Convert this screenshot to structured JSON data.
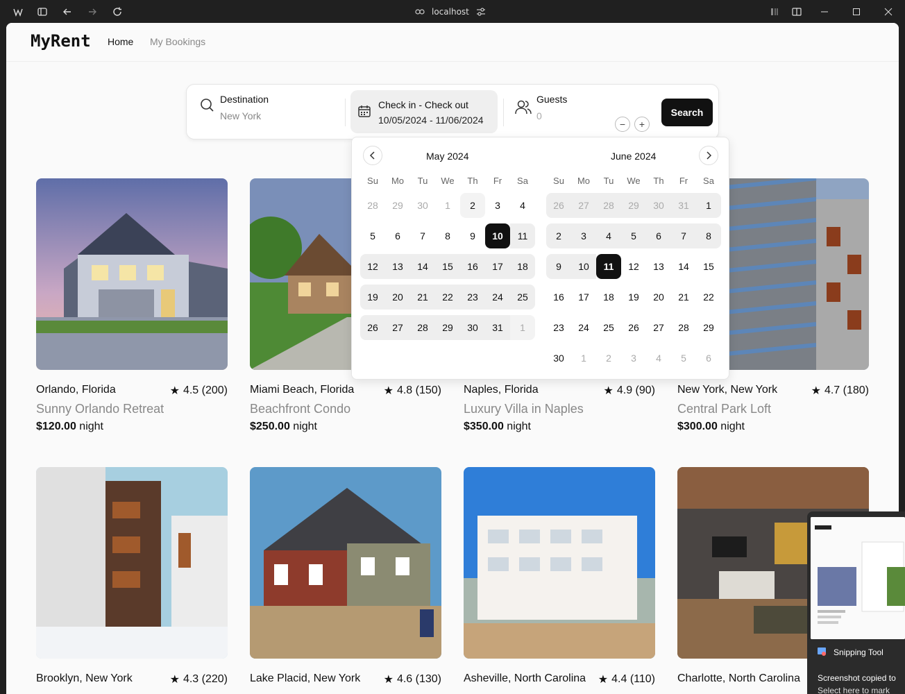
{
  "browser": {
    "url": "localhost"
  },
  "nav": {
    "logo": "MyRent",
    "links": [
      "Home",
      "My Bookings"
    ]
  },
  "search": {
    "destination_label": "Destination",
    "destination_value": "New York",
    "dates_label": "Check in - Check out",
    "dates_value": "10/05/2024 - 11/06/2024",
    "guests_label": "Guests",
    "guests_value": "0",
    "decrement": "−",
    "increment": "+",
    "button": "Search"
  },
  "calendar": {
    "weekdays": [
      "Su",
      "Mo",
      "Tu",
      "We",
      "Th",
      "Fr",
      "Sa"
    ],
    "left_title": "May 2024",
    "right_title": "June 2024",
    "left_weeks": [
      [
        "28",
        "29",
        "30",
        "1",
        "2",
        "3",
        "4"
      ],
      [
        "5",
        "6",
        "7",
        "8",
        "9",
        "10",
        "11"
      ],
      [
        "12",
        "13",
        "14",
        "15",
        "16",
        "17",
        "18"
      ],
      [
        "19",
        "20",
        "21",
        "22",
        "23",
        "24",
        "25"
      ],
      [
        "26",
        "27",
        "28",
        "29",
        "30",
        "31",
        "1"
      ]
    ],
    "right_weeks": [
      [
        "26",
        "27",
        "28",
        "29",
        "30",
        "31",
        "1"
      ],
      [
        "2",
        "3",
        "4",
        "5",
        "6",
        "7",
        "8"
      ],
      [
        "9",
        "10",
        "11",
        "12",
        "13",
        "14",
        "15"
      ],
      [
        "16",
        "17",
        "18",
        "19",
        "20",
        "21",
        "22"
      ],
      [
        "23",
        "24",
        "25",
        "26",
        "27",
        "28",
        "29"
      ],
      [
        "30",
        "1",
        "2",
        "3",
        "4",
        "5",
        "6"
      ]
    ]
  },
  "listings": [
    {
      "location": "Orlando, Florida",
      "rating": "4.5 (200)",
      "title": "Sunny Orlando Retreat",
      "price": "$120.00",
      "unit": "night"
    },
    {
      "location": "Miami Beach, Florida",
      "rating": "4.8 (150)",
      "title": "Beachfront Condo",
      "price": "$250.00",
      "unit": "night"
    },
    {
      "location": "Naples, Florida",
      "rating": "4.9 (90)",
      "title": "Luxury Villa in Naples",
      "price": "$350.00",
      "unit": "night"
    },
    {
      "location": "New York, New York",
      "rating": "4.7 (180)",
      "title": "Central Park Loft",
      "price": "$300.00",
      "unit": "night"
    },
    {
      "location": "Brooklyn, New York",
      "rating": "4.3 (220)"
    },
    {
      "location": "Lake Placid, New York",
      "rating": "4.6 (130)"
    },
    {
      "location": "Asheville, North Carolina",
      "rating": "4.4 (110)"
    },
    {
      "location": "Charlotte, North Carolina",
      "rating": ""
    }
  ],
  "toast": {
    "app": "Snipping Tool",
    "message": "Screenshot copied to",
    "sub": "Select here to mark"
  },
  "colors": {
    "accent": "#111111",
    "range_bg": "#eeeeee",
    "muted_text": "#888888"
  }
}
